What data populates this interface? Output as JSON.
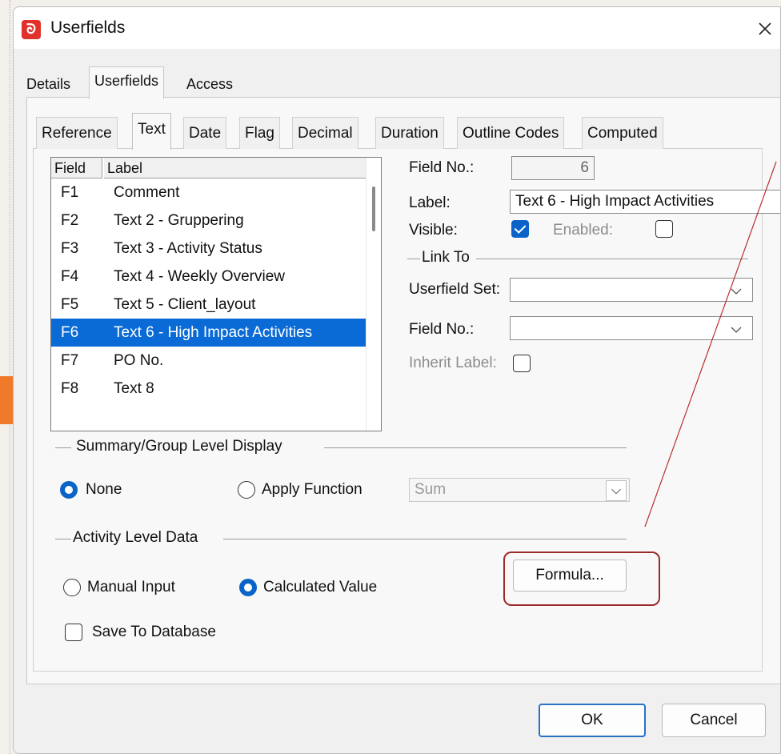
{
  "window": {
    "title": "Userfields",
    "app_icon_glyph": "ᘐ"
  },
  "outer_tabs": [
    "Details",
    "Userfields",
    "Access"
  ],
  "inner_tabs": [
    "Reference",
    "Text",
    "Date",
    "Flag",
    "Decimal",
    "Duration",
    "Outline Codes",
    "Computed"
  ],
  "list": {
    "headers": [
      "Field",
      "Label"
    ],
    "rows": [
      {
        "field": "F1",
        "label": "Comment"
      },
      {
        "field": "F2",
        "label": "Text 2 - Gruppering"
      },
      {
        "field": "F3",
        "label": "Text 3 - Activity Status"
      },
      {
        "field": "F4",
        "label": "Text 4 - Weekly Overview"
      },
      {
        "field": "F5",
        "label": "Text 5 - Client_layout"
      },
      {
        "field": "F6",
        "label": "Text 6 - High Impact Activities"
      },
      {
        "field": "F7",
        "label": "PO No."
      },
      {
        "field": "F8",
        "label": "Text 8"
      }
    ],
    "selected_index": 5
  },
  "details": {
    "field_no_label": "Field No.:",
    "field_no_value": "6",
    "label_label": "Label:",
    "label_value": "Text 6 - High Impact Activities",
    "visible_label": "Visible:",
    "enabled_label": "Enabled:",
    "link_to_label": "Link To",
    "userfield_set_label": "Userfield Set:",
    "link_field_no_label": "Field No.:",
    "inherit_label": "Inherit Label:"
  },
  "summary": {
    "group_title": "Summary/Group Level Display",
    "none_label": "None",
    "apply_label": "Apply Function",
    "function_value": "Sum"
  },
  "activity": {
    "group_title": "Activity Level Data",
    "manual_label": "Manual Input",
    "calculated_label": "Calculated Value",
    "formula_button": "Formula...",
    "save_label": "Save To Database"
  },
  "buttons": {
    "ok": "OK",
    "cancel": "Cancel"
  },
  "colors": {
    "accent": "#0a64c8",
    "selection": "#0a6bd6",
    "annotation": "#9c2a2a",
    "app_icon": "#e0312a"
  }
}
